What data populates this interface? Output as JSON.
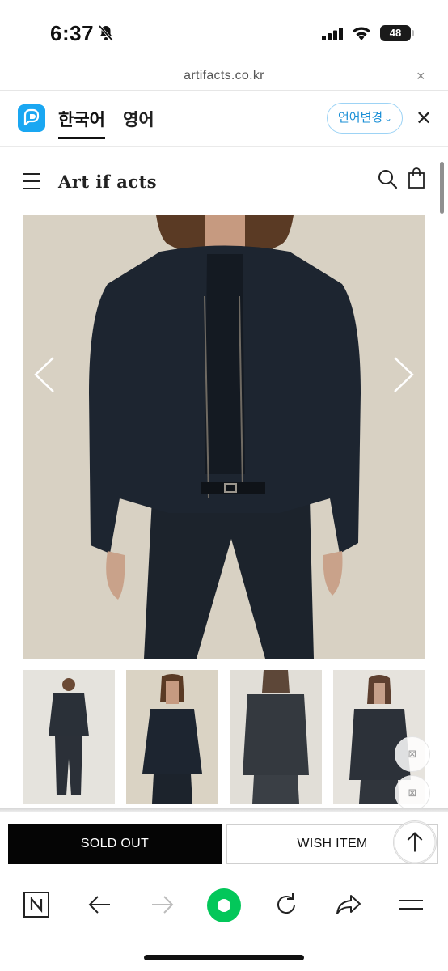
{
  "status_bar": {
    "time": "6:37",
    "battery": "48",
    "icons": [
      "bell-slash-icon",
      "cellular-signal-icon",
      "wifi-icon",
      "battery-icon"
    ]
  },
  "url_bar": {
    "url": "artifacts.co.kr",
    "close_icon": "×"
  },
  "translate_bar": {
    "icon": "papago-icon",
    "source_lang": "한국어",
    "target_lang": "영어",
    "change_button": "언어변경",
    "close_icon": "✕"
  },
  "site_header": {
    "logo": "Art if acts",
    "icons": [
      "menu-icon",
      "search-icon",
      "shopping-bag-icon"
    ]
  },
  "gallery": {
    "main_image": "product-photo-navy-jacket",
    "thumbnails": [
      "thumb-full-front",
      "thumb-close-front",
      "thumb-back",
      "thumb-side"
    ],
    "prev_icon": "chevron-left-icon",
    "next_icon": "chevron-right-icon",
    "floating_icons": [
      "⊠",
      "⊠"
    ]
  },
  "actions": {
    "sold_out": "SOLD OUT",
    "wish_item": "WISH ITEM",
    "scroll_top_icon": "arrow-up-icon"
  },
  "toolbar": {
    "icons": [
      "naver-n-icon",
      "back-arrow-icon",
      "forward-arrow-icon",
      "green-home-icon",
      "refresh-icon",
      "share-icon",
      "menu-icon"
    ]
  },
  "colors": {
    "accent_blue": "#1aa7f2",
    "naver_green": "#03c75a",
    "photo_backdrop": "#d7d1c4",
    "jacket_navy": "#1d2530"
  }
}
